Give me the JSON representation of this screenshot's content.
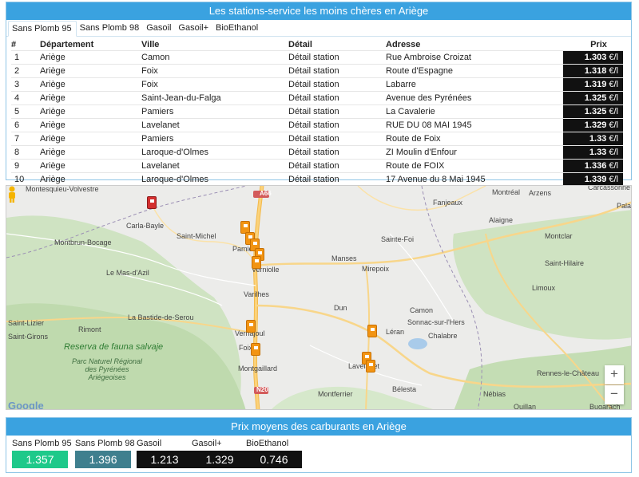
{
  "stations_panel": {
    "title": "Les stations-service les moins chères en Ariège",
    "tabs": [
      "Sans Plomb 95",
      "Sans Plomb 98",
      "Gasoil",
      "Gasoil+",
      "BioEthanol"
    ],
    "columns": [
      "#",
      "Département",
      "Ville",
      "Détail",
      "Adresse",
      "Prix"
    ],
    "rows": [
      {
        "n": "1",
        "dep": "Ariège",
        "ville": "Camon",
        "detail": "Détail station",
        "adresse": "Rue Ambroise Croizat",
        "prix": "1.303",
        "unit": "€/l"
      },
      {
        "n": "2",
        "dep": "Ariège",
        "ville": "Foix",
        "detail": "Détail station",
        "adresse": "Route d'Espagne",
        "prix": "1.318",
        "unit": "€/l"
      },
      {
        "n": "3",
        "dep": "Ariège",
        "ville": "Foix",
        "detail": "Détail station",
        "adresse": "Labarre",
        "prix": "1.319",
        "unit": "€/l"
      },
      {
        "n": "4",
        "dep": "Ariège",
        "ville": "Saint-Jean-du-Falga",
        "detail": "Détail station",
        "adresse": "Avenue des Pyrénées",
        "prix": "1.325",
        "unit": "€/l"
      },
      {
        "n": "5",
        "dep": "Ariège",
        "ville": "Pamiers",
        "detail": "Détail station",
        "adresse": "La Cavalerie",
        "prix": "1.325",
        "unit": "€/l"
      },
      {
        "n": "6",
        "dep": "Ariège",
        "ville": "Lavelanet",
        "detail": "Détail station",
        "adresse": "RUE DU 08 MAI 1945",
        "prix": "1.329",
        "unit": "€/l"
      },
      {
        "n": "7",
        "dep": "Ariège",
        "ville": "Pamiers",
        "detail": "Détail station",
        "adresse": "Route de Foix",
        "prix": "1.33",
        "unit": "€/l"
      },
      {
        "n": "8",
        "dep": "Ariège",
        "ville": "Laroque-d'Olmes",
        "detail": "Détail station",
        "adresse": "ZI Moulin d'Enfour",
        "prix": "1.33",
        "unit": "€/l"
      },
      {
        "n": "9",
        "dep": "Ariège",
        "ville": "Lavelanet",
        "detail": "Détail station",
        "adresse": "Route de FOIX",
        "prix": "1.336",
        "unit": "€/l"
      },
      {
        "n": "10",
        "dep": "Ariège",
        "ville": "Laroque-d'Olmes",
        "detail": "Détail station",
        "adresse": "17 Avenue du 8 Mai 1945",
        "prix": "1.339",
        "unit": "€/l"
      }
    ]
  },
  "map": {
    "places": [
      "Montesquieu-Volvestre",
      "Carla-Bayle",
      "Saint-Michel",
      "Montbrun-Bocage",
      "Le Mas-d'Azil",
      "Pamiers",
      "Verniolle",
      "Varilhes",
      "Manses",
      "Mirepoix",
      "Sainte-Foi",
      "Fanjeaux",
      "Montréal",
      "Arzens",
      "Carcassonne",
      "Alaigne",
      "Montclar",
      "Saint-Hilaire",
      "Limoux",
      "Palaja",
      "Dun",
      "Camon",
      "Sonnac-sur-l'Hers",
      "Léran",
      "Chalabre",
      "La Bastide-de-Serou",
      "Rimont",
      "Saint-Lizier",
      "Saint-Girons",
      "Vernajoul",
      "Foix",
      "Montgaillard",
      "Lavelanet",
      "Bélesta",
      "Montferrier",
      "Nébias",
      "Quillan",
      "Rennes-le-Château",
      "Bugarach"
    ],
    "park_label": "Reserva de fauna salvaje",
    "park_label2": "Parc Naturel Régional des Pyrénées Ariégeoises",
    "roads": [
      "A66",
      "N20"
    ],
    "zoom_in": "+",
    "zoom_out": "−",
    "google": "Google"
  },
  "averages_panel": {
    "title": "Prix moyens des carburants en Ariège",
    "items": [
      {
        "label": "Sans Plomb 95",
        "value": "1.357",
        "color": "#1ec98a"
      },
      {
        "label": "Sans Plomb 98",
        "value": "1.396",
        "color": "#3f7f8e"
      },
      {
        "label": "Gasoil",
        "value": "1.213",
        "color": "#111111"
      },
      {
        "label": "Gasoil+",
        "value": "1.329",
        "color": "#111111"
      },
      {
        "label": "BioEthanol",
        "value": "0.746",
        "color": "#111111"
      }
    ]
  }
}
